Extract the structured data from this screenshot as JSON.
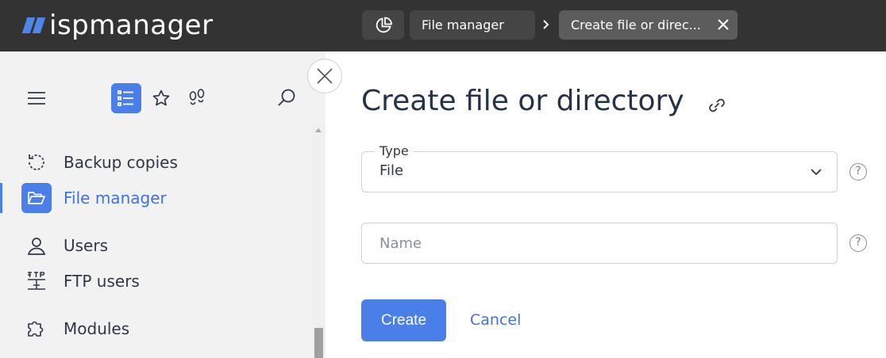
{
  "app": {
    "logo_text": "ispmanager",
    "brand_color": "#4a7ee8"
  },
  "breadcrumbs": {
    "home_icon": "dashboard-pie-icon",
    "items": [
      {
        "label": "File manager"
      }
    ],
    "active": {
      "label": "Create file or direc..."
    }
  },
  "sidebar": {
    "toolbar": {
      "menu_icon": "hamburger-menu-icon",
      "list_icon": "list-view-icon",
      "favorites_icon": "star-icon",
      "recent_icon": "footsteps-icon",
      "search_icon": "search-icon"
    },
    "items": [
      {
        "label": "Backup copies",
        "icon": "backup-icon",
        "active": false
      },
      {
        "label": "File manager",
        "icon": "folder-open-icon",
        "active": true
      },
      {
        "label": "Users",
        "icon": "user-icon",
        "active": false
      },
      {
        "label": "FTP users",
        "icon": "ftp-icon",
        "active": false
      },
      {
        "label": "Modules",
        "icon": "puzzle-icon",
        "active": false
      }
    ]
  },
  "form": {
    "title": "Create file or directory",
    "type_field": {
      "label": "Type",
      "value": "File"
    },
    "name_field": {
      "placeholder": "Name",
      "value": ""
    },
    "help_glyph": "?",
    "create_label": "Create",
    "cancel_label": "Cancel"
  }
}
